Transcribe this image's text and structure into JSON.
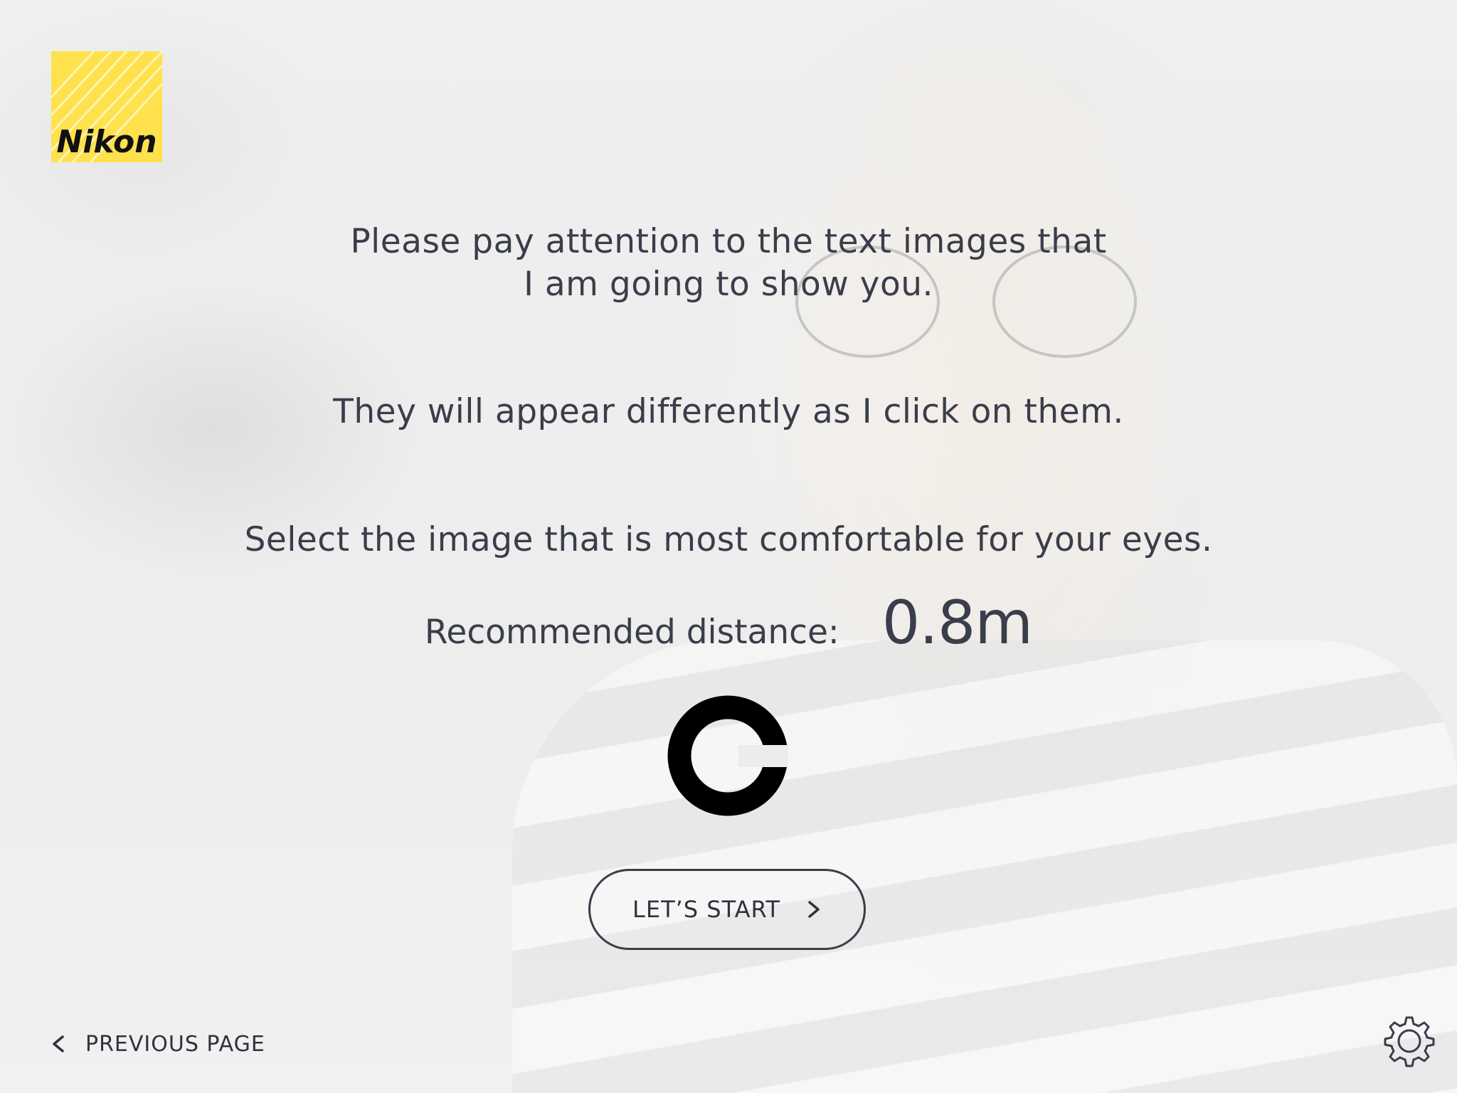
{
  "brand": {
    "logo_text": "Nikon",
    "logo_color": "#ffe14d"
  },
  "instructions": {
    "line1a": "Please pay attention to the text images that",
    "line1b": "I am going to show you.",
    "line2": "They will appear differently as I click on them.",
    "line3": "Select the image that is most comfortable for your eyes."
  },
  "distance": {
    "label": "Recommended distance:",
    "value": "0.8m"
  },
  "optotype": {
    "icon": "landolt-c-icon",
    "color": "#000000"
  },
  "actions": {
    "start_label": "LET’S START",
    "previous_label": "PREVIOUS PAGE"
  },
  "icons": {
    "start": "chevron-right-icon",
    "previous": "chevron-left-icon",
    "settings": "gear-icon"
  },
  "colors": {
    "text": "#3a3d4a",
    "background": "#ececec"
  }
}
